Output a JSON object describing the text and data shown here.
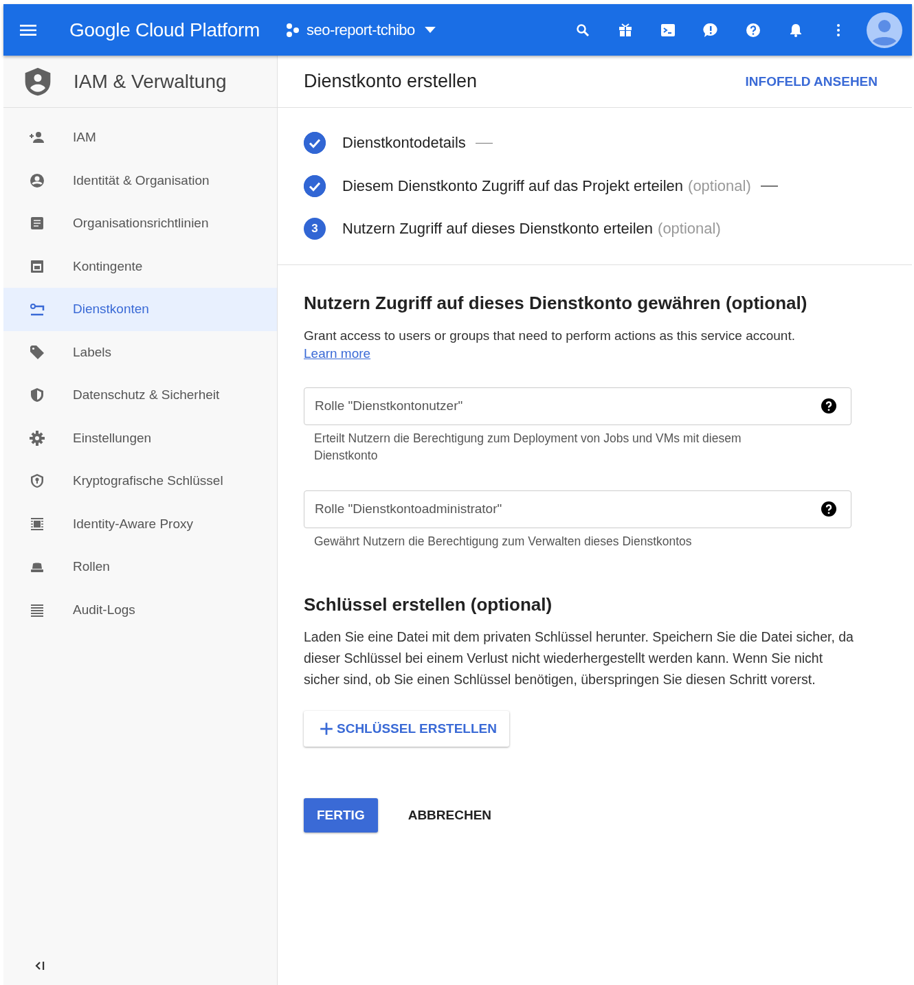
{
  "topbar": {
    "product": "Google Cloud Platform",
    "project": "seo-report-tchibo"
  },
  "sidebar": {
    "title": "IAM & Verwaltung",
    "items": [
      {
        "label": "IAM",
        "selected": false
      },
      {
        "label": "Identität & Organisation",
        "selected": false
      },
      {
        "label": "Organisationsrichtlinien",
        "selected": false
      },
      {
        "label": "Kontingente",
        "selected": false
      },
      {
        "label": "Dienstkonten",
        "selected": true
      },
      {
        "label": "Labels",
        "selected": false
      },
      {
        "label": "Datenschutz & Sicherheit",
        "selected": false
      },
      {
        "label": "Einstellungen",
        "selected": false
      },
      {
        "label": "Kryptografische Schlüssel",
        "selected": false
      },
      {
        "label": "Identity-Aware Proxy",
        "selected": false
      },
      {
        "label": "Rollen",
        "selected": false
      },
      {
        "label": "Audit-Logs",
        "selected": false
      }
    ]
  },
  "page": {
    "title": "Dienstkonto erstellen",
    "info_link": "INFOFELD ANSEHEN"
  },
  "steps": [
    {
      "kind": "done",
      "label": "Dienstkontodetails",
      "connector": true
    },
    {
      "kind": "done",
      "label": "Diesem Dienstkonto Zugriff auf das Projekt erteilen",
      "optional": "(optional)",
      "connector": true
    },
    {
      "kind": "current",
      "number": "3",
      "label": "Nutzern Zugriff auf dieses Dienstkonto erteilen",
      "optional": "(optional)",
      "connector": false
    }
  ],
  "access_section": {
    "heading": "Nutzern Zugriff auf dieses Dienstkonto gewähren (optional)",
    "description": "Grant access to users or groups that need to perform actions as this service account.",
    "link": "Learn more",
    "fields": [
      {
        "placeholder": "Rolle \"Dienstkontonutzer\"",
        "hint": "Erteilt Nutzern die Berechtigung zum Deployment von Jobs und VMs mit diesem Dienstkonto"
      },
      {
        "placeholder": "Rolle \"Dienstkontoadministrator\"",
        "hint": "Gewährt Nutzern die Berechtigung zum Verwalten dieses Dienstkontos"
      }
    ]
  },
  "key_section": {
    "heading": "Schlüssel erstellen (optional)",
    "description": "Laden Sie eine Datei mit dem privaten Schlüssel herunter. Speichern Sie die Datei sicher, da dieser Schlüssel bei einem Verlust nicht wiederhergestellt werden kann. Wenn Sie nicht sicher sind, ob Sie einen Schlüssel benötigen, überspringen Sie diesen Schritt vorerst.",
    "button": "SCHLÜSSEL ERSTELLEN"
  },
  "actions": {
    "primary": "FERTIG",
    "secondary": "ABBRECHEN"
  }
}
